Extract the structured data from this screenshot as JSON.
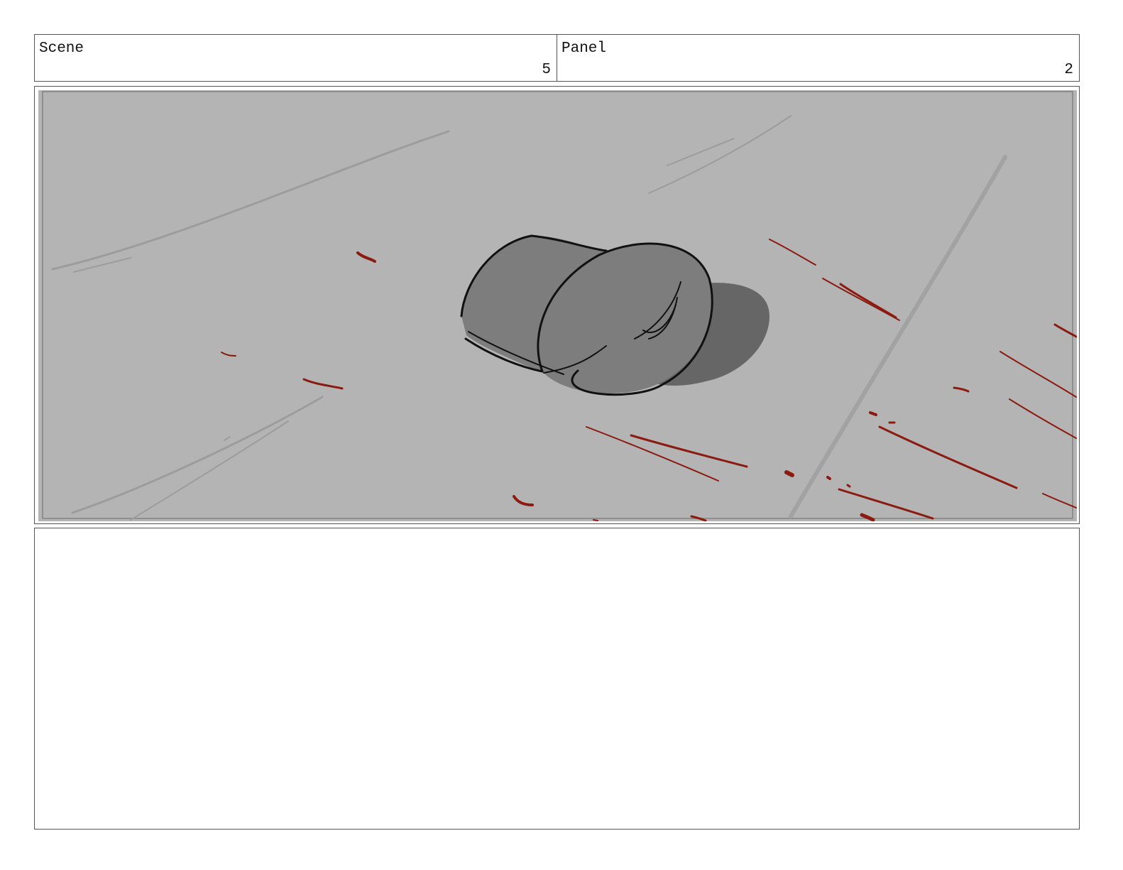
{
  "header": {
    "scene_label": "Scene",
    "scene_value": "5",
    "panel_label": "Panel",
    "panel_value": "2"
  },
  "frame": {
    "icon": "cap-on-floor-drawing",
    "colors": {
      "background": "#b4b4b4",
      "cap_fill": "#7d7d7d",
      "shadow": "#666666",
      "floor_lines": "#9c9c9c",
      "blood": "#8b1a10",
      "outline": "#111111"
    }
  },
  "notes": {
    "text": ""
  }
}
